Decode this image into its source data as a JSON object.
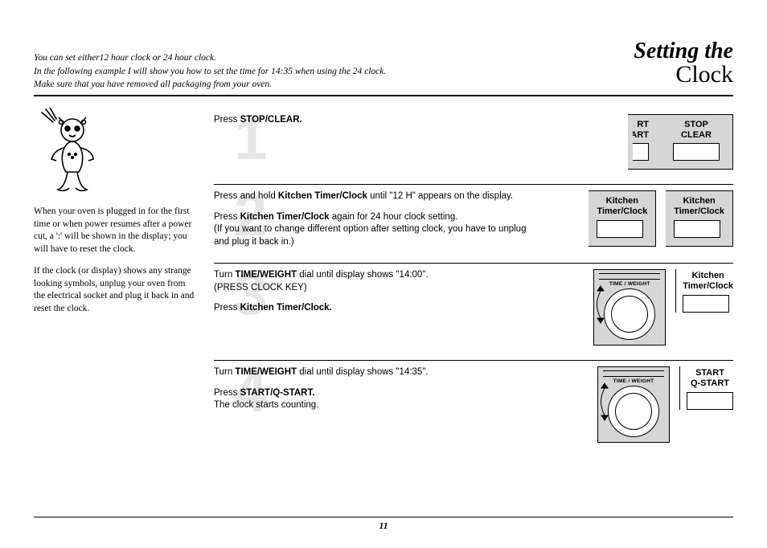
{
  "title": {
    "line1": "Setting the",
    "line2": "Clock"
  },
  "intro": {
    "l1": "You can set either12 hour clock or 24 hour clock.",
    "l2": "In the following example I will show you how to set the time for 14:35 when using the 24 clock.",
    "l3": "Make sure that you have removed all packaging from your oven."
  },
  "sidebar": {
    "p1": "When your oven is plugged in for the first time or when power resumes after a power cut, a ':' will be shown in the display; you will have to reset the clock.",
    "p2": "If the clock (or display) shows any strange looking symbols, unplug your oven from the electrical socket and plug it back in and reset the clock."
  },
  "steps": {
    "s1": {
      "num": "1",
      "t1a": "Press ",
      "t1b": "STOP/CLEAR.",
      "panel_left1": "RT",
      "panel_left2": "ART",
      "panel_stop": "STOP",
      "panel_clear": "CLEAR"
    },
    "s2": {
      "num": "2",
      "t1a": "Press and hold ",
      "t1b": "Kitchen Timer/Clock",
      "t1c": " until \"12 H\" appears on the display.",
      "t2a": "Press ",
      "t2b": "Kitchen Timer/Clock",
      "t2c": " again for 24 hour clock setting.",
      "t3": "(If you want to change different option after setting clock, you have to unplug and plug it back in.)",
      "label": "Kitchen\nTimer/Clock"
    },
    "s3": {
      "num": "3",
      "t1a": "Turn ",
      "t1b": "TIME/WEIGHT",
      "t1c": " dial until display shows \"14:00\".",
      "t2": "(PRESS CLOCK KEY)",
      "t3a": "Press ",
      "t3b": "Kitchen Timer/Clock.",
      "dial_label": "TIME / WEIGHT",
      "side_label": "Kitchen\nTimer/Clock"
    },
    "s4": {
      "num": "4",
      "t1a": "Turn ",
      "t1b": "TIME/WEIGHT",
      "t1c": " dial until display shows \"14:35\".",
      "t2a": "Press ",
      "t2b": "START/Q-START.",
      "t3": "The clock starts counting.",
      "dial_label": "TIME / WEIGHT",
      "side_label": "START\nQ-START"
    }
  },
  "page_number": "11"
}
